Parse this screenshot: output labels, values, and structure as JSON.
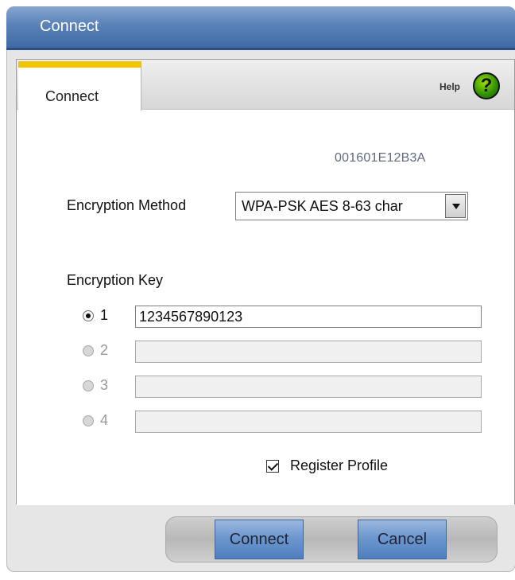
{
  "window": {
    "title": "Connect"
  },
  "tabs": [
    {
      "label": "Connect"
    }
  ],
  "help": {
    "label": "Help",
    "icon": "help-icon",
    "icon_glyph": "?"
  },
  "network": {
    "mac_address": "001601E12B3A"
  },
  "encryption": {
    "method_label": "Encryption Method",
    "method_value": "WPA-PSK AES 8-63 char",
    "key_label": "Encryption Key",
    "keys": [
      {
        "number": "1",
        "value": "1234567890123",
        "selected": true,
        "enabled": true
      },
      {
        "number": "2",
        "value": "",
        "selected": false,
        "enabled": false
      },
      {
        "number": "3",
        "value": "",
        "selected": false,
        "enabled": false
      },
      {
        "number": "4",
        "value": "",
        "selected": false,
        "enabled": false
      }
    ]
  },
  "profile": {
    "register_label": "Register Profile",
    "register_checked": true
  },
  "buttons": {
    "connect": "Connect",
    "cancel": "Cancel"
  },
  "colors": {
    "titlebar": "#5a82b8",
    "tab_accent": "#f1c500",
    "button_blue": "#6e97cf"
  }
}
